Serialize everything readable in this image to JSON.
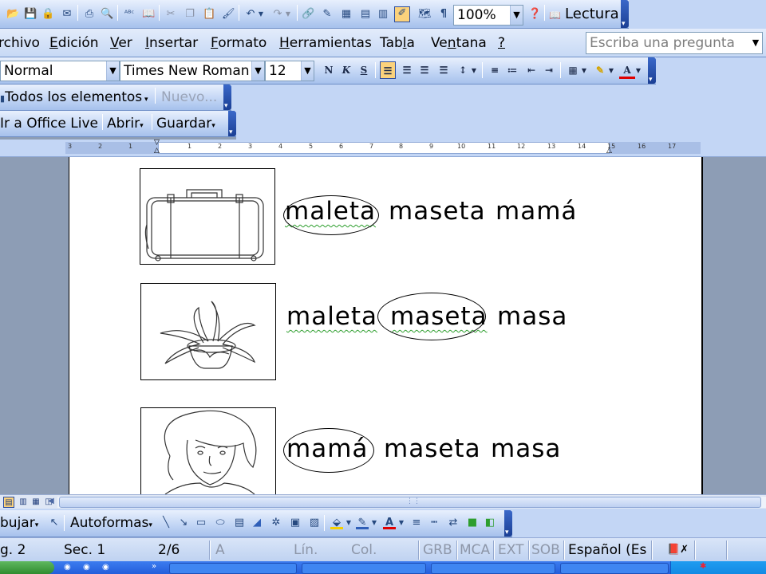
{
  "standard_toolbar": {
    "zoom_value": "100%",
    "reading_button_label": "Lectura",
    "icons": [
      "new-icon",
      "open-icon",
      "save-icon",
      "permission-icon",
      "email-icon",
      "print-icon",
      "print-preview-icon",
      "spelling-icon",
      "research-icon",
      "cut-icon",
      "copy-icon",
      "paste-icon",
      "format-painter-icon",
      "undo-icon",
      "redo-icon",
      "hyperlink-icon",
      "tables-borders-icon",
      "insert-table-icon",
      "insert-excel-icon",
      "columns-icon",
      "drawing-icon",
      "document-map-icon",
      "show-formatting-icon",
      "help-icon"
    ],
    "show_formatting_glyph": "¶"
  },
  "menu_bar": {
    "items": [
      {
        "pre": "",
        "u": "",
        "post": "rchivo"
      },
      {
        "pre": "",
        "u": "E",
        "post": "dición"
      },
      {
        "pre": "",
        "u": "V",
        "post": "er"
      },
      {
        "pre": "",
        "u": "I",
        "post": "nsertar"
      },
      {
        "pre": "",
        "u": "F",
        "post": "ormato"
      },
      {
        "pre": "",
        "u": "H",
        "post": "erramientas"
      },
      {
        "pre": "Tab",
        "u": "l",
        "post": "a"
      },
      {
        "pre": "Ve",
        "u": "n",
        "post": "tana"
      },
      {
        "pre": "",
        "u": "?",
        "post": ""
      }
    ],
    "help_search_placeholder": "Escriba una pregunta"
  },
  "formatting_toolbar": {
    "style_value": "Normal",
    "font_value": "Times New Roman",
    "size_value": "12",
    "bold_glyph": "N",
    "italic_glyph": "K",
    "underline_glyph": "S"
  },
  "elements_toolbar": {
    "all_elements_label": "Todos los elementos",
    "new_label": "Nuevo..."
  },
  "office_live_toolbar": {
    "go_to_label": "Ir a Office Live",
    "open_label": "Abrir",
    "save_label": "Guardar"
  },
  "ruler": {
    "left_numbers": [
      "3",
      "2",
      "1"
    ],
    "right_numbers": [
      "1",
      "2",
      "3",
      "4",
      "5",
      "6",
      "7",
      "8",
      "9",
      "10",
      "11",
      "12",
      "13",
      "14",
      "15",
      "16",
      "17"
    ]
  },
  "document": {
    "rows": [
      {
        "image": "suitcase",
        "words": [
          "maleta",
          "maseta",
          "mamá"
        ],
        "circled_index": 0
      },
      {
        "image": "potted-plant",
        "words": [
          "maleta",
          "maseta",
          "masa"
        ],
        "circled_index": 1
      },
      {
        "image": "mother",
        "words": [
          "mamá",
          "maseta",
          "masa"
        ],
        "circled_index": 0
      }
    ]
  },
  "drawing_toolbar": {
    "draw_label": "bujar",
    "autoshapes_label": "Autoformas"
  },
  "status_bar": {
    "page": "g. 2",
    "section": "Sec. 1",
    "page_count": "2/6",
    "at": "A",
    "line": "Lín.",
    "column": "Col.",
    "rec": "GRB",
    "trk": "MCA",
    "ext": "EXT",
    "ovr": "SOB",
    "language": "Español (Es"
  },
  "colors": {
    "toolbar_gradient_top": "#e8f0fd",
    "toolbar_gradient_bottom": "#a6c1ec",
    "grip": "#1b3f94",
    "workspace": "#8d9db5",
    "spell_underline": "#2e9e2e",
    "active_button": "#fbd27c",
    "taskbar": "#245edb"
  }
}
